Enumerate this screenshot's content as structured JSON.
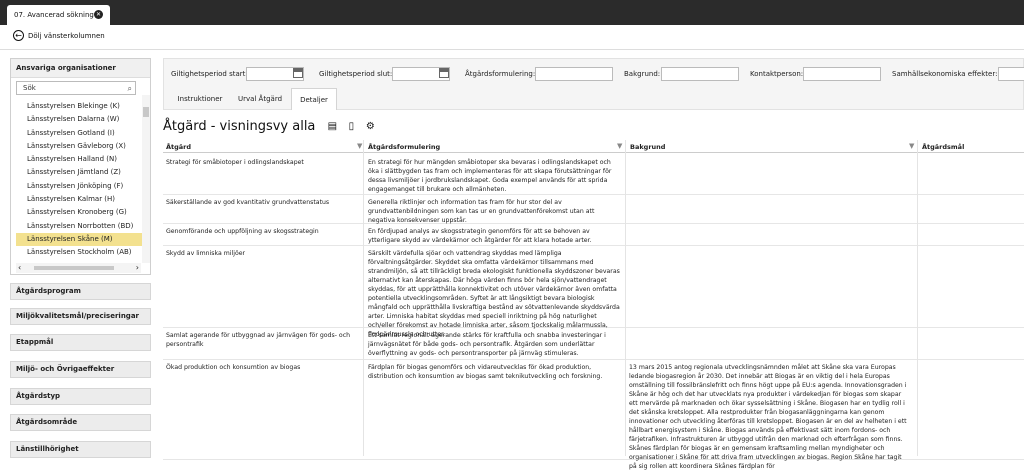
{
  "window": {
    "tab_label": "07. Avancerad sökning",
    "collapse_label": "Dölj vänsterkolumnen"
  },
  "sidebar": {
    "org_title": "Ansvariga organisationer",
    "search_value": "Sök",
    "orgs": [
      "Länsstyrelsen Blekinge (K)",
      "Länsstyrelsen Dalarna (W)",
      "Länsstyrelsen Gotland (I)",
      "Länsstyrelsen Gävleborg (X)",
      "Länsstyrelsen Halland (N)",
      "Länsstyrelsen Jämtland (Z)",
      "Länsstyrelsen Jönköping (F)",
      "Länsstyrelsen Kalmar (H)",
      "Länsstyrelsen Kronoberg (G)",
      "Länsstyrelsen Norrbotten (BD)",
      "Länsstyrelsen Skåne (M)",
      "Länsstyrelsen Stockholm (AB)"
    ],
    "selected_index": 10,
    "sections": [
      "Åtgärdsprogram",
      "Miljökvalitetsmål/preciseringar",
      "Etappmål",
      "Miljö- och Övrigaeffekter",
      "Åtgärdstyp",
      "Åtgärdsområde",
      "Länstillhörighet"
    ]
  },
  "filters": {
    "start_label": "Giltighetsperiod start:",
    "end_label": "Giltighetsperiod slut:",
    "formulering_label": "Åtgärdsformulering:",
    "bakgrund_label": "Bakgrund:",
    "kontakt_label": "Kontaktperson:",
    "samhall_label": "Samhällsekonomiska effekter:"
  },
  "subtabs": [
    "Instruktioner",
    "Urval Åtgärd",
    "Detaljer"
  ],
  "view_title": "Åtgärd - visningsvy alla",
  "table": {
    "headers": [
      "Åtgärd",
      "Åtgärdsformulering",
      "Bakgrund",
      "Åtgärdsmål"
    ],
    "rows": [
      {
        "atgard": "Strategi för småbiotoper i odlingslandskapet",
        "form": "En strategi för hur mängden småbiotoper ska bevaras i odlingslandskapet och öka i slättbygden tas fram och implementeras för att skapa förutsättningar för dessa livsmiljöer i jordbrukslandskapet. Goda exempel används för att sprida engagemanget till brukare och allmänheten.",
        "bak": ""
      },
      {
        "atgard": "Säkerställande av god kvantitativ grundvattenstatus",
        "form": "Generella riktlinjer och information tas fram för hur stor del av grundvattenbildningen som kan tas ur en grundvattenförekomst utan att negativa konsekvenser uppstår.",
        "bak": ""
      },
      {
        "atgard": "Genomförande och uppföljning av skogsstrategin",
        "form": "En fördjupad analys av skogsstrategin genomförs för att se behoven av ytterligare skydd av värdekärnor och åtgärder för att klara hotade arter.",
        "bak": ""
      },
      {
        "atgard": "Skydd av limniska miljöer",
        "form": "Särskilt värdefulla sjöar och vattendrag skyddas med lämpliga förvaltningsåtgärder. Skyddet ska omfatta värdekärnor tillsammans med strandmiljön, så att tillräckligt breda ekologiskt funktionella skyddszoner bevaras alternativt kan återskapas. Där höga värden finns bör hela sjön/vattendraget skyddas, för att upprätthålla konnektivitet och utöver värdekärnor även omfatta potentiella utvecklingsområden. Syftet är att långsiktigt bevara biologisk mångfald och upprätthålla livskraftiga bestånd av sötvattenlevande skyddsvärda arter. Limniska habitat skyddas med speciell inriktning på hög naturlighet och/eller förekomst av hotade limniska arter, såsom tjockskalig målarmussla, flodpärlmussla och utter.",
        "bak": ""
      },
      {
        "atgard": "Samlat agerande för utbyggnad av järnvägen för gods- och persontrafik",
        "form": "Ett samlat regionalt agerande stärks för kraftfulla och snabba investeringar i järnvägsnätet för både gods- och persontrafik. Åtgärden som underlättar överflyttning av gods- och persontransporter på järnväg stimuleras.",
        "bak": ""
      },
      {
        "atgard": "Ökad produktion och konsumtion av biogas",
        "form": "Färdplan för biogas genomförs och vidareutvecklas för ökad produktion, distribution och konsumtion av biogas samt teknikutveckling och forskning.",
        "bak": "13 mars 2015 antog regionala utvecklingsnämnden målet att Skåne ska vara Europas ledande biogasregion år 2030. Det innebär att Biogas är en viktig del i hela Europas omställning till fossilbränslefritt och finns högt uppe på EU:s agenda. Innovationsgraden i Skåne är hög och det har utvecklats nya produkter i värdekedjan för biogas som skapar ett mervärde på marknaden och ökar sysselsättning i Skåne. Biogasen har en tydlig roll i det skånska kretsloppet. Alla restprodukter från biogasanläggningarna kan genom innovationer och utveckling återföras till kretsloppet. Biogasen är en del av helheten i ett hållbart energisystem i Skåne. Biogas används på effektivast sätt inom fordons- och färjetrafiken. Infrastrukturen är utbyggd utifrån den marknad och efterfrågan som finns. Skånes färdplan för biogas är en gemensam kraftsamling mellan myndigheter och organisationer i Skåne för att driva fram utvecklingen av biogas. Region Skåne har tagit på sig rollen att koordinera Skånes färdplan för"
      }
    ]
  }
}
